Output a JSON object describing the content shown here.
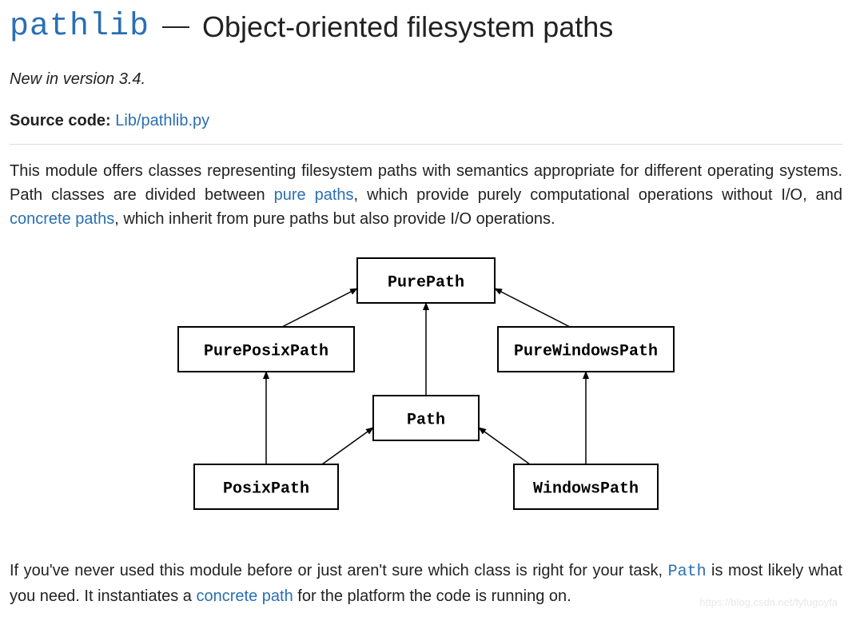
{
  "title": {
    "module": "pathlib",
    "rest": "Object-oriented filesystem paths"
  },
  "version_note": "New in version 3.4.",
  "source": {
    "label": "Source code:",
    "link": "Lib/pathlib.py"
  },
  "intro": {
    "t1": "This module offers classes representing filesystem paths with semantics appropriate for different operating systems. Path classes are divided between ",
    "link1": "pure paths",
    "t2": ", which provide purely computational operations without I/O, and ",
    "link2": "concrete paths",
    "t3": ", which inherit from pure paths but also provide I/O operations."
  },
  "diagram": {
    "nodes": {
      "purepath": "PurePath",
      "pureposix": "PurePosixPath",
      "purewindows": "PureWindowsPath",
      "path": "Path",
      "posix": "PosixPath",
      "windows": "WindowsPath"
    }
  },
  "closing": {
    "t1": "If you've never used this module before or just aren't sure which class is right for your task, ",
    "code": "Path",
    "t2": " is most likely what you need. It instantiates a ",
    "link": "concrete path",
    "t3": " for the platform the code is running on."
  },
  "watermark": "https://blog.csdn.net/fyfugoyfa"
}
